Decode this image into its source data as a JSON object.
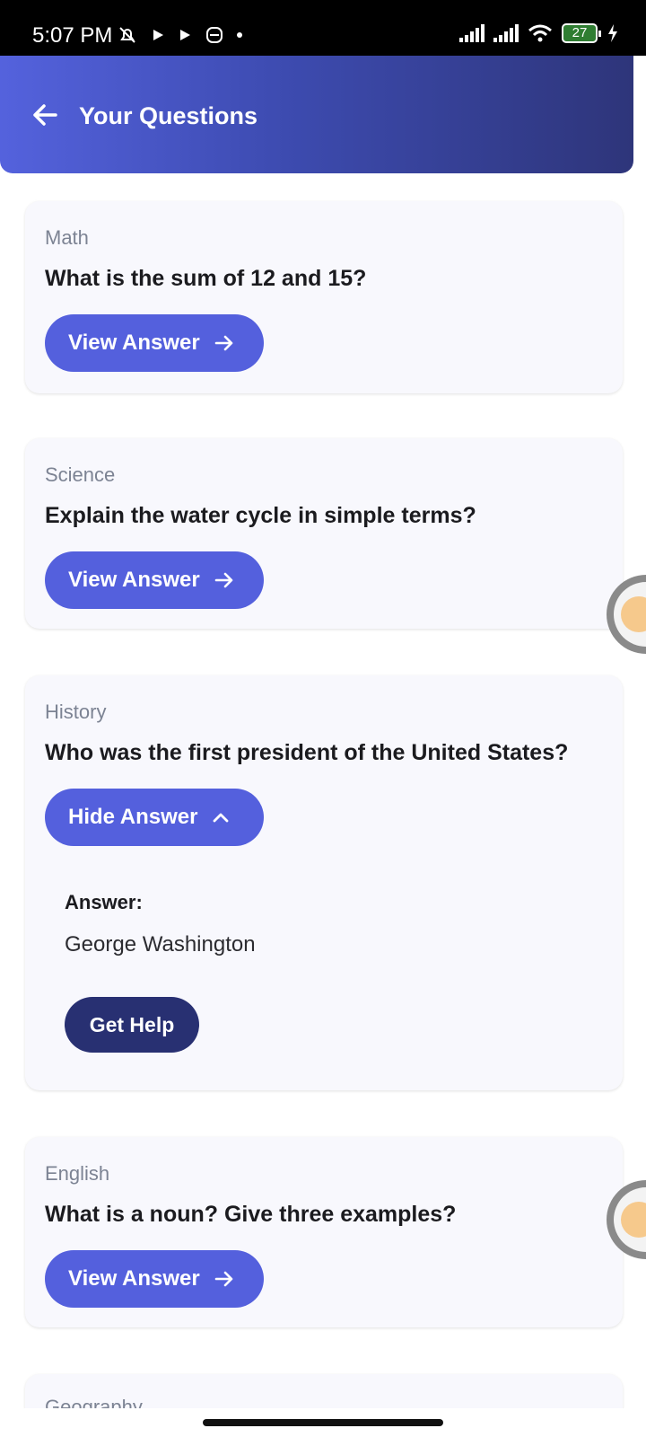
{
  "status_bar": {
    "time": "5:07 PM",
    "battery": "27",
    "icons": [
      "mute-icon",
      "play-icon",
      "play-icon",
      "sync-icon",
      "dot-icon",
      "signal-icon",
      "signal-icon",
      "wifi-icon",
      "battery-icon",
      "charging-icon"
    ]
  },
  "header": {
    "title": "Your Questions",
    "back_icon": "arrow-left-icon"
  },
  "colors": {
    "header_gradient": [
      "#5462dd",
      "#2e357a"
    ],
    "button": "#5460dd",
    "help_button": "#283072",
    "card_bg": "#f8f8fd"
  },
  "questions": [
    {
      "subject": "Math",
      "question": "What is the sum of 12 and 15?",
      "button_label": "View Answer",
      "button_icon": "arrow-right-icon"
    },
    {
      "subject": "Science",
      "question": "Explain the water cycle in simple terms?",
      "button_label": "View Answer",
      "button_icon": "arrow-right-icon"
    },
    {
      "subject": "History",
      "question": "Who was the first president of the United States?",
      "button_label": "Hide Answer",
      "button_icon": "chevron-up-icon",
      "answer_label": "Answer:",
      "answer_text": "George Washington",
      "help_label": "Get Help"
    },
    {
      "subject": "English",
      "question": "What is a noun? Give three examples?",
      "button_label": "View Answer",
      "button_icon": "arrow-right-icon"
    },
    {
      "subject": "Geography"
    }
  ]
}
